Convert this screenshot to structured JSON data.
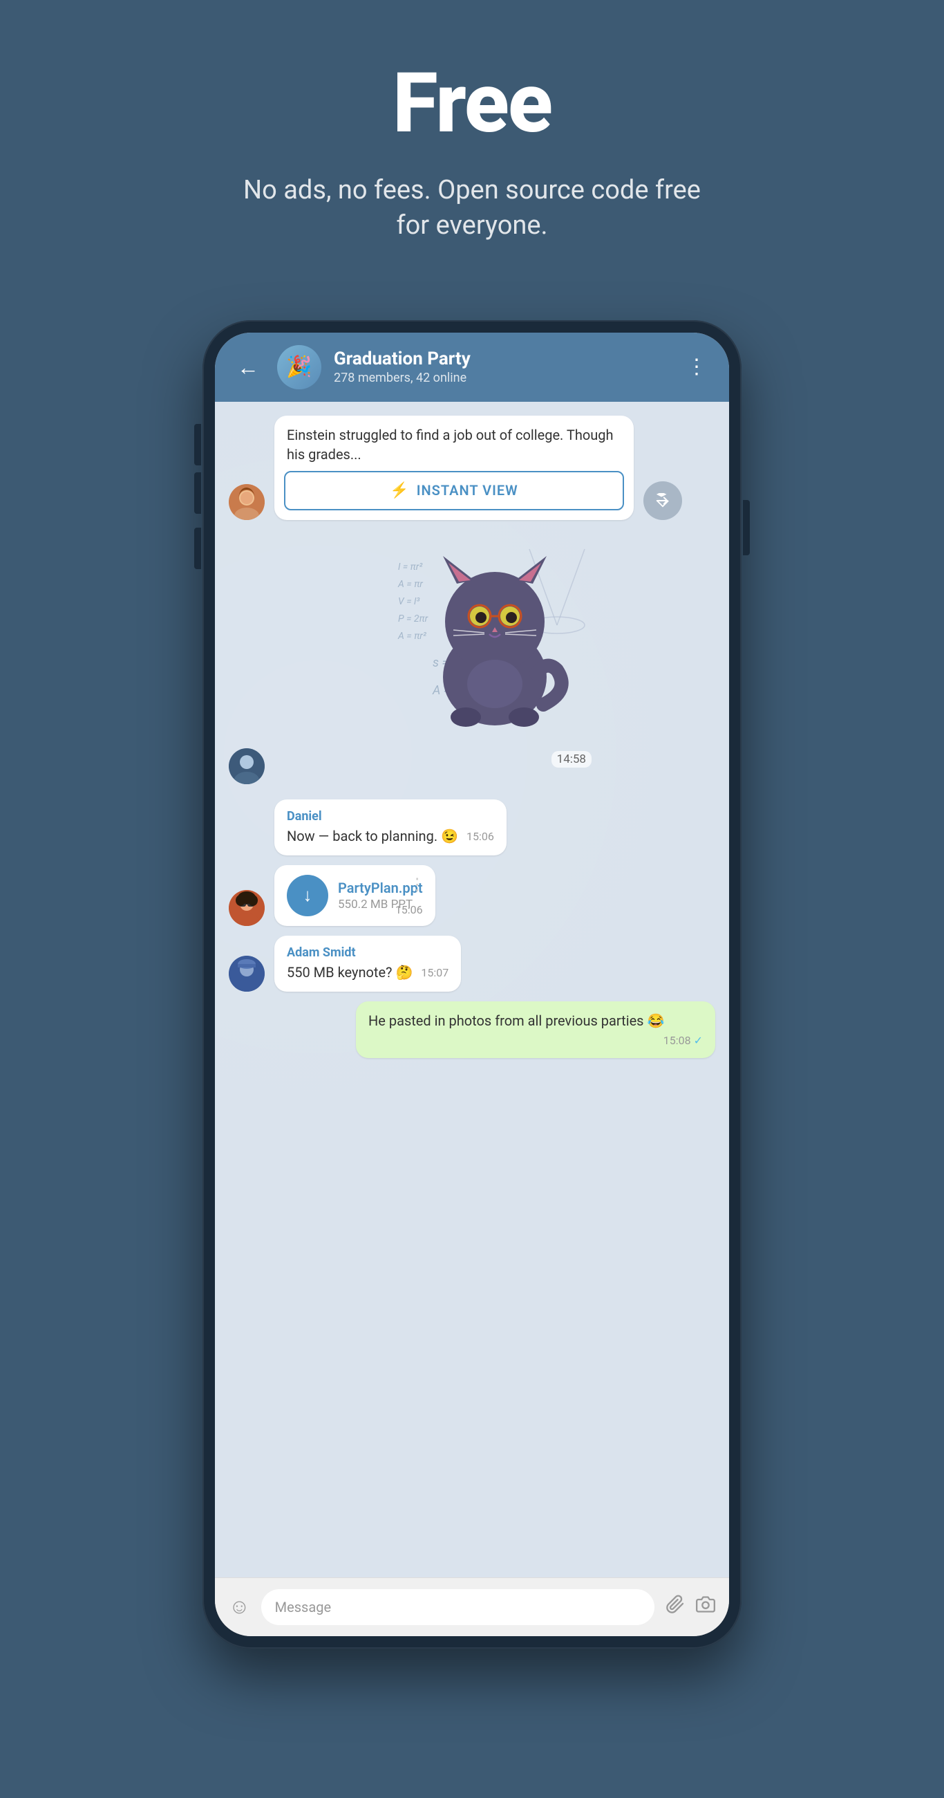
{
  "hero": {
    "title": "Free",
    "subtitle": "No ads, no fees. Open source code free for everyone."
  },
  "chat": {
    "back_label": "←",
    "group_name": "Graduation Party",
    "group_meta": "278 members, 42 online",
    "more_label": "⋮"
  },
  "messages": [
    {
      "id": "article-msg",
      "type": "article",
      "text": "Einstein struggled to find a job out of college. Though his grades...",
      "instant_view_label": "INSTANT VIEW",
      "avatar": "girl"
    },
    {
      "id": "sticker-msg",
      "type": "sticker",
      "time": "14:58",
      "avatar": "guy1"
    },
    {
      "id": "daniel-msg",
      "type": "text",
      "sender": "Daniel",
      "text": "Now — back to planning. 😉",
      "time": "15:06",
      "avatar": "none"
    },
    {
      "id": "file-msg",
      "type": "file",
      "filename": "PartyPlan.ppt",
      "filesize": "550.2 MB PPT",
      "time": "15:06",
      "avatar": "guy2"
    },
    {
      "id": "adam-msg",
      "type": "text",
      "sender": "Adam Smidt",
      "text": "550 MB keynote? 🤔",
      "time": "15:07",
      "avatar": "guy3"
    },
    {
      "id": "outgoing-msg",
      "type": "text",
      "outgoing": true,
      "text": "He pasted in photos from all previous parties 😂",
      "time": "15:08",
      "check": true
    }
  ],
  "input": {
    "placeholder": "Message",
    "emoji_icon": "☺",
    "attach_icon": "📎",
    "camera_icon": "📷"
  },
  "colors": {
    "header_bg": "#517da2",
    "body_bg": "#3d5a73",
    "chat_bg": "#dae3ed",
    "sender_color": "#4a90c4",
    "outgoing_bg": "#dcf8c6"
  }
}
